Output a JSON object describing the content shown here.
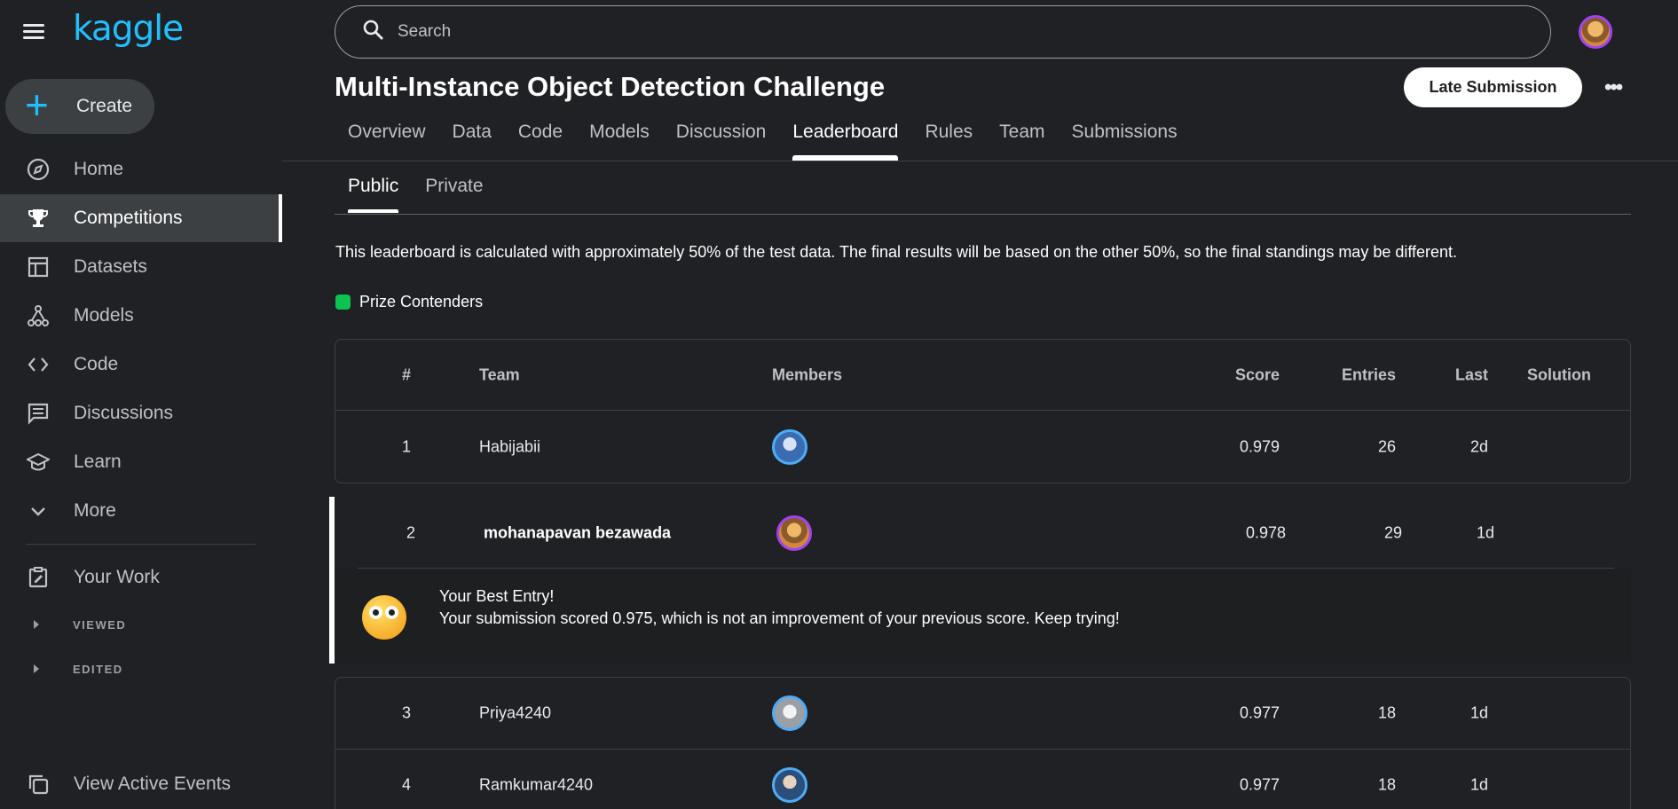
{
  "app": {
    "logo": "kaggle"
  },
  "search": {
    "placeholder": "Search"
  },
  "sidebar": {
    "create_label": "Create",
    "items": [
      {
        "label": "Home"
      },
      {
        "label": "Competitions"
      },
      {
        "label": "Datasets"
      },
      {
        "label": "Models"
      },
      {
        "label": "Code"
      },
      {
        "label": "Discussions"
      },
      {
        "label": "Learn"
      },
      {
        "label": "More"
      },
      {
        "label": "Your Work"
      }
    ],
    "sub_items": [
      "VIEWED",
      "EDITED"
    ],
    "bottom_item": "View Active Events"
  },
  "page": {
    "title": "Multi-Instance Object Detection Challenge",
    "late_submission": "Late Submission",
    "more_menu": "•••"
  },
  "tabs": [
    "Overview",
    "Data",
    "Code",
    "Models",
    "Discussion",
    "Leaderboard",
    "Rules",
    "Team",
    "Submissions"
  ],
  "subtabs": [
    "Public",
    "Private"
  ],
  "notice": "This leaderboard is calculated with approximately 50% of the test data. The final results will be based on the other 50%, so the final standings may be different.",
  "legend": {
    "label": "Prize Contenders",
    "color": "#0bc34e"
  },
  "leaderboard": {
    "headers": {
      "rank": "#",
      "team": "Team",
      "members": "Members",
      "score": "Score",
      "entries": "Entries",
      "last": "Last",
      "solution": "Solution"
    },
    "rows": [
      {
        "rank": "1",
        "team": "Habijabii",
        "score": "0.979",
        "entries": "26",
        "last": "2d"
      },
      {
        "rank": "2",
        "team": "mohanapavan bezawada",
        "score": "0.978",
        "entries": "29",
        "last": "1d"
      },
      {
        "rank": "3",
        "team": "Priya4240",
        "score": "0.977",
        "entries": "18",
        "last": "1d"
      },
      {
        "rank": "4",
        "team": "Ramkumar4240",
        "score": "0.977",
        "entries": "18",
        "last": "1d"
      }
    ],
    "best_entry": {
      "title": "Your Best Entry!",
      "message": "Your submission scored 0.975, which is not an improvement of your previous score. Keep trying!"
    }
  },
  "colors": {
    "accent": "#20beff",
    "background": "#202124",
    "avatar_ring": "#a142f4"
  }
}
